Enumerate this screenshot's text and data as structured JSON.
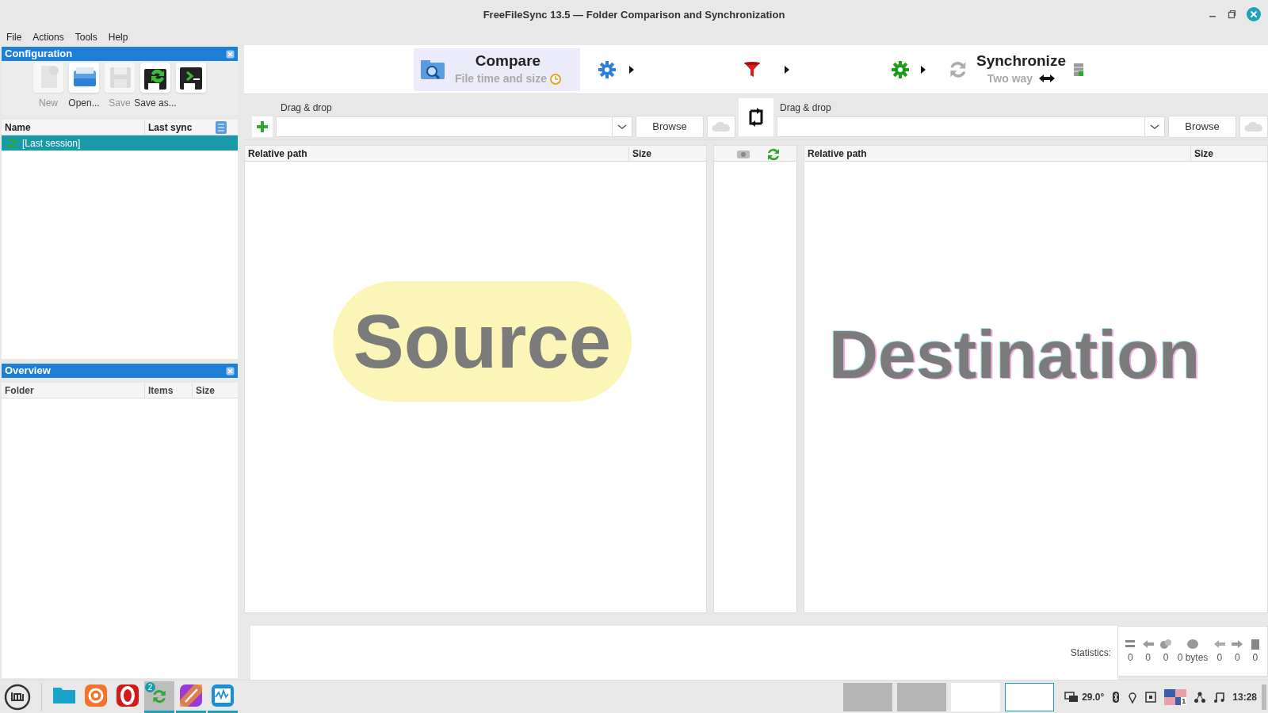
{
  "window": {
    "title": "FreeFileSync 13.5 — Folder Comparison and Synchronization"
  },
  "menu": [
    "File",
    "Actions",
    "Tools",
    "Help"
  ],
  "configuration": {
    "title": "Configuration",
    "tools": [
      {
        "label": "New",
        "disabled": true
      },
      {
        "label": "Open...",
        "disabled": false
      },
      {
        "label": "Save",
        "disabled": true
      },
      {
        "label": "Save as...",
        "disabled": false
      },
      {
        "disabled": false
      }
    ],
    "columns": [
      "Name",
      "Last sync"
    ],
    "rows": [
      {
        "name": "[Last session]",
        "selected": true
      }
    ]
  },
  "overview": {
    "title": "Overview",
    "columns": [
      "Folder",
      "Items",
      "Size"
    ]
  },
  "toolbar": {
    "compare": {
      "label": "Compare",
      "sublabel": "File time and size"
    },
    "synchronize": {
      "label": "Synchronize",
      "sublabel": "Two way"
    }
  },
  "folders": [
    {
      "label": "Drag & drop",
      "browse": "Browse"
    },
    {
      "label": "Drag & drop",
      "browse": "Browse"
    }
  ],
  "left_grid": {
    "columns": [
      "Relative path",
      "Size"
    ]
  },
  "right_grid": {
    "columns": [
      "Relative path",
      "Size"
    ]
  },
  "overlays": [
    {
      "kind": "highlight",
      "text": "Source"
    },
    {
      "kind": "outlined",
      "text": "Destination"
    }
  ],
  "statistics": {
    "label": "Statistics:",
    "values": [
      "0",
      "0",
      "0",
      "0 bytes",
      "0",
      "0",
      "0"
    ]
  },
  "taskbar": {
    "apps": [
      {
        "kind": "files",
        "running": false
      },
      {
        "kind": "firefox",
        "running": false
      },
      {
        "kind": "opera",
        "running": false
      },
      {
        "kind": "sync",
        "running": true,
        "selected": true,
        "badge": "2"
      },
      {
        "kind": "paint",
        "running": true,
        "selected": false
      },
      {
        "kind": "monitor",
        "running": true,
        "selected": false
      }
    ],
    "windows": [
      {
        "selected": false
      },
      {
        "selected": false
      },
      {
        "selected": false
      },
      {
        "selected": true
      }
    ],
    "temperature": "29.0°",
    "layout_badge": "1",
    "clock": "13:28"
  }
}
